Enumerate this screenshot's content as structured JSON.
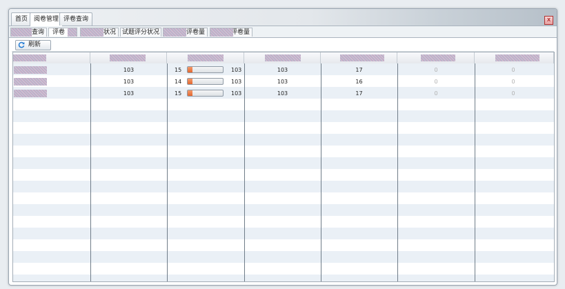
{
  "top_tabs": [
    {
      "label": "首页",
      "active": false
    },
    {
      "label": "阅卷管理",
      "active": true
    },
    {
      "label": "评卷查询",
      "active": false
    }
  ],
  "close_symbol": "x",
  "sub_tabs": [
    {
      "label": "查询",
      "active": false
    },
    {
      "label": "评卷",
      "active": true
    },
    {
      "label": "状况",
      "active": false
    },
    {
      "label": "试题评分状况",
      "active": false
    },
    {
      "label": "评卷量",
      "active": false
    },
    {
      "label": "评卷量",
      "active": false
    }
  ],
  "toolbar": {
    "refresh_label": "刷新",
    "refresh_icon": "refresh-icon"
  },
  "grid": {
    "rows": [
      {
        "col2": "103",
        "progress_count": "15",
        "progress_total": "103",
        "progress_fraction": 0.146,
        "col4": "103",
        "col5": "17",
        "col6": "0",
        "col7": "0"
      },
      {
        "col2": "103",
        "progress_count": "14",
        "progress_total": "103",
        "progress_fraction": 0.136,
        "col4": "103",
        "col5": "16",
        "col6": "0",
        "col7": "0"
      },
      {
        "col2": "103",
        "progress_count": "15",
        "progress_total": "103",
        "progress_fraction": 0.146,
        "col4": "103",
        "col5": "17",
        "col6": "0",
        "col7": "0"
      }
    ]
  },
  "colors": {
    "progress_fill": "#e2672e",
    "row_stripe": "#eaf0f6",
    "accent_blue": "#2a7fd4"
  }
}
